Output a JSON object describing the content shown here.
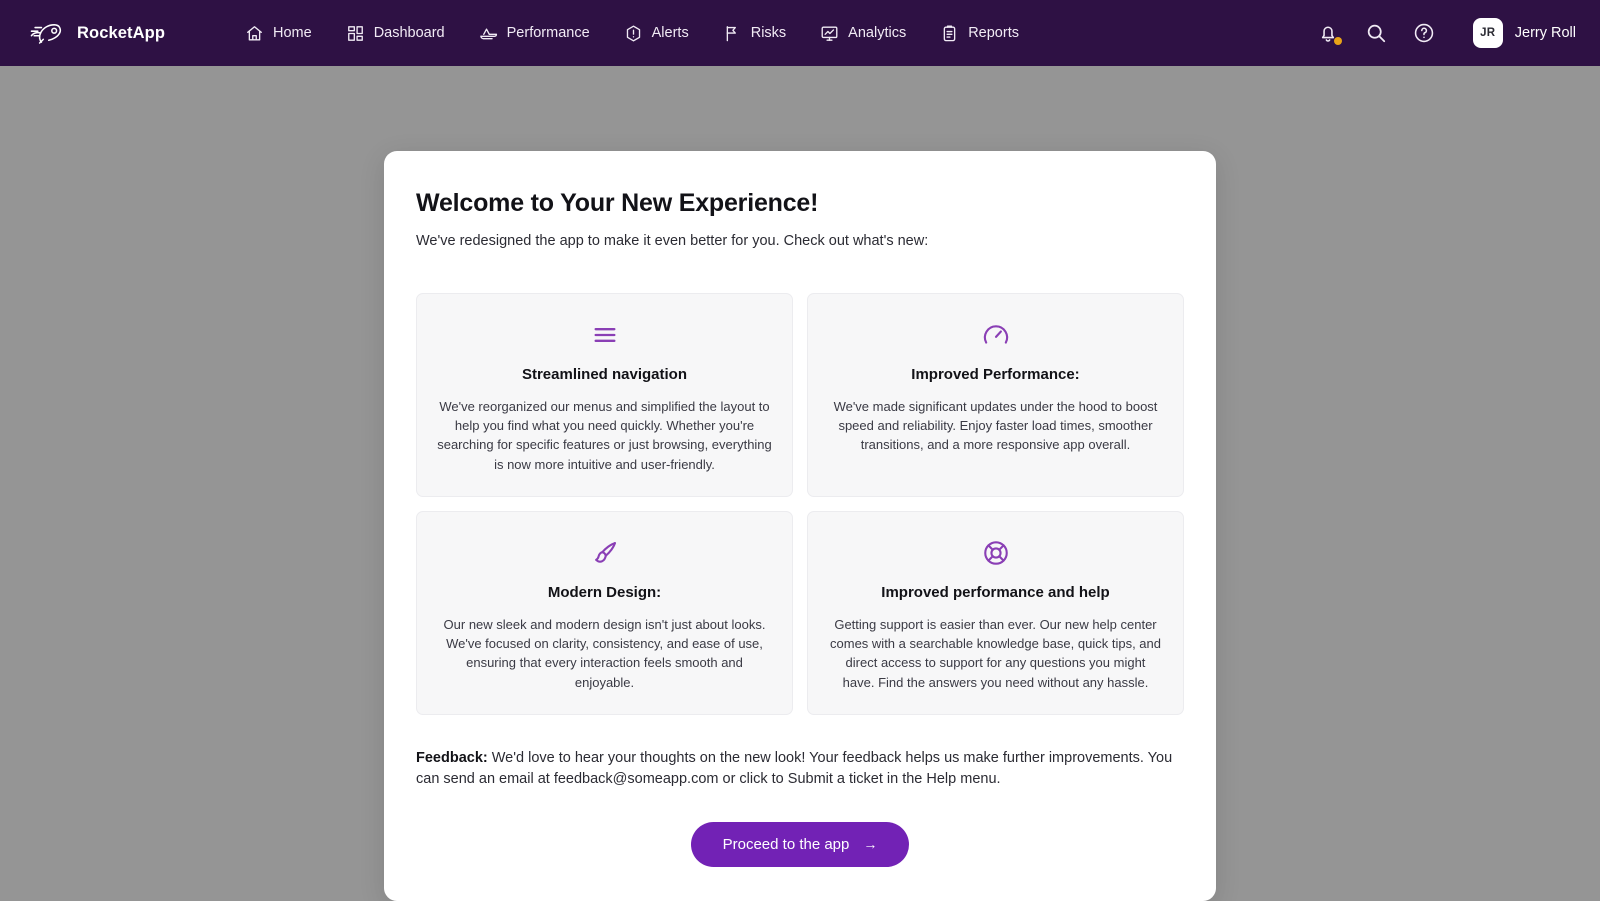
{
  "navbar": {
    "brand": {
      "logo_icon": "rocket-icon",
      "name": "RocketApp"
    },
    "links": [
      {
        "icon": "home-icon",
        "label": "Home"
      },
      {
        "icon": "dashboard-grid-icon",
        "label": "Dashboard"
      },
      {
        "icon": "speedboat-icon",
        "label": "Performance"
      },
      {
        "icon": "alert-hexagon-icon",
        "label": "Alerts"
      },
      {
        "icon": "flag-icon",
        "label": "Risks"
      },
      {
        "icon": "analytics-monitor-icon",
        "label": "Analytics"
      },
      {
        "icon": "clipboard-icon",
        "label": "Reports"
      }
    ],
    "actions": [
      {
        "icon": "notification-bell-icon",
        "has_badge": true
      },
      {
        "icon": "search-icon",
        "has_badge": false
      },
      {
        "icon": "help-circle-icon",
        "has_badge": false
      }
    ],
    "user": {
      "initials": "JR",
      "name": "Jerry Roll"
    }
  },
  "modal": {
    "title": "Welcome to Your New Experience!",
    "subtitle": "We've redesigned the app to make it even better for you. Check out what's new:",
    "features": [
      {
        "icon": "menu-lines-icon",
        "title": "Streamlined navigation",
        "desc": "We've reorganized our menus and simplified the layout to help you find what you need quickly. Whether you're searching for specific features or just browsing, everything is now more intuitive and user-friendly."
      },
      {
        "icon": "gauge-icon",
        "title": "Improved Performance:",
        "desc": "We've made significant updates under the hood to boost speed and reliability. Enjoy faster load times, smoother transitions, and a more responsive app overall."
      },
      {
        "icon": "paintbrush-icon",
        "title": "Modern Design:",
        "desc": "Our new sleek and modern design isn't just about looks. We've focused on clarity, consistency, and ease of use, ensuring that every interaction feels smooth and enjoyable."
      },
      {
        "icon": "lifebuoy-icon",
        "title": "Improved performance and help",
        "desc": "Getting support is easier than ever. Our new help center comes with a searchable knowledge base, quick tips, and direct access to support for any questions you might have. Find the answers you need without any hassle."
      }
    ],
    "feedback": {
      "label": "Feedback:",
      "text": " We'd love to hear your thoughts on the new look! Your feedback helps us make further improvements. You can send an email at feedback@someapp.com or click to Submit a ticket in the Help menu."
    },
    "cta": {
      "label": "Proceed to the app",
      "arrow": "→"
    }
  },
  "colors": {
    "navbar_bg": "#2e1144",
    "page_bg": "#959595",
    "accent_purple": "#7222b5",
    "icon_purple": "#8a3fb5",
    "badge_orange": "#e8a317",
    "card_bg": "#f7f7f8"
  }
}
